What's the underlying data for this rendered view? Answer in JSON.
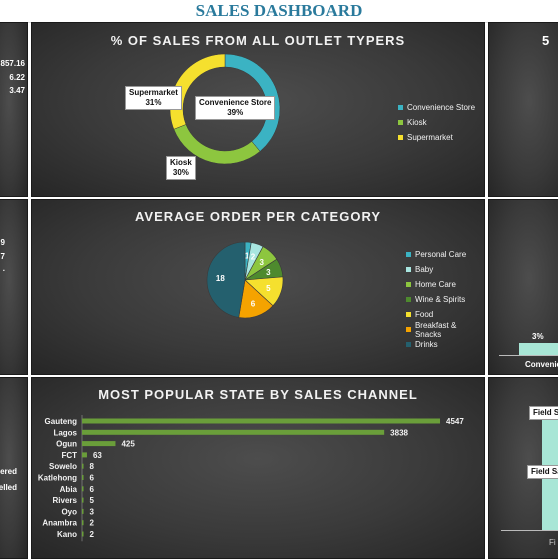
{
  "dashboard": {
    "title": "SALES DASHBOARD"
  },
  "left_edge": {
    "top_values": [
      "857.16",
      "6.22",
      "3.47"
    ],
    "mid_values": [
      "9",
      "7",
      "."
    ],
    "bottom_values": [
      "ered",
      "elled"
    ]
  },
  "right_edge": {
    "top_text": "5",
    "mid_label": "3%",
    "mid_category": "Convenie",
    "bottom_callout_1": "Field S",
    "bottom_callout_2": "Field Sa",
    "bottom_axis": "Fi"
  },
  "chart_data": [
    {
      "type": "pie",
      "subtype": "donut",
      "title": "% OF SALES FROM ALL OUTLET TYPERS",
      "categories": [
        "Convenience Store",
        "Kiosk",
        "Supermarket"
      ],
      "values": [
        39,
        30,
        31
      ],
      "labels": [
        "39%",
        "30%",
        "31%"
      ],
      "colors": [
        "#3bb3c3",
        "#8dc63f",
        "#f5e02e"
      ],
      "legend": "right"
    },
    {
      "type": "pie",
      "title": "AVERAGE ORDER PER CATEGORY",
      "categories": [
        "Personal Care",
        "Baby",
        "Home Care",
        "Wine & Spirits",
        "Food",
        "Breakfast & Snacks",
        "Drinks"
      ],
      "values": [
        1,
        2,
        3,
        3,
        5,
        6,
        18
      ],
      "colors": [
        "#3bb3c3",
        "#a8e6e0",
        "#8dc63f",
        "#4e8a2e",
        "#f5e02e",
        "#f5a300",
        "#24606e"
      ],
      "legend": "right"
    },
    {
      "type": "bar",
      "orientation": "horizontal",
      "title": "MOST POPULAR STATE BY SALES CHANNEL",
      "categories": [
        "Gauteng",
        "Lagos",
        "Ogun",
        "FCT",
        "Sowelo",
        "Katlehong",
        "Abia",
        "Rivers",
        "Oyo",
        "Anambra",
        "Kano"
      ],
      "values": [
        4547,
        3838,
        425,
        63,
        8,
        6,
        6,
        5,
        3,
        2,
        2
      ],
      "color": "#6a9e3a"
    }
  ]
}
